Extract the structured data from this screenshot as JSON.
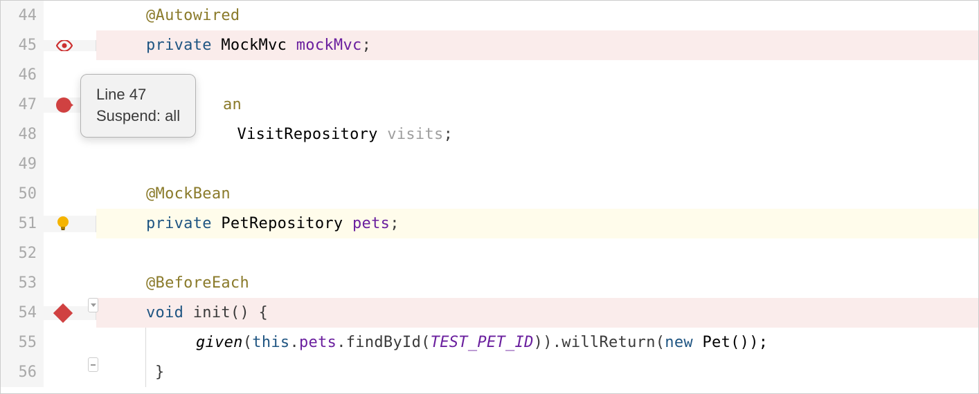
{
  "lines": [
    {
      "num": 44,
      "content_parts": [
        {
          "cls": "c-annotation",
          "text": "@Autowired"
        }
      ],
      "indent": 1
    },
    {
      "num": 45,
      "content_parts": [
        {
          "cls": "c-keyword",
          "text": "private"
        },
        {
          "cls": "",
          "text": " MockMvc "
        },
        {
          "cls": "c-field",
          "text": "mockMvc"
        },
        {
          "cls": "c-punc",
          "text": ";"
        }
      ],
      "indent": 1,
      "bg": "bg-pink",
      "icon": "eye"
    },
    {
      "num": 46,
      "content_parts": [],
      "indent": 0
    },
    {
      "num": 47,
      "content_parts": [
        {
          "cls": "c-annotation",
          "text": "an"
        }
      ],
      "indent": 1,
      "icon": "breakpoint",
      "obscured": true
    },
    {
      "num": 48,
      "content_parts": [
        {
          "cls": "",
          "text": " VisitRepository "
        },
        {
          "cls": "c-visitsfield",
          "text": "visits"
        },
        {
          "cls": "c-punc",
          "text": ";"
        }
      ],
      "indent": 1,
      "obscured_prefix": true
    },
    {
      "num": 49,
      "content_parts": [],
      "indent": 0
    },
    {
      "num": 50,
      "content_parts": [
        {
          "cls": "c-annotation",
          "text": "@MockBean"
        }
      ],
      "indent": 1
    },
    {
      "num": 51,
      "content_parts": [
        {
          "cls": "c-keyword",
          "text": "private"
        },
        {
          "cls": "",
          "text": " PetRepository "
        },
        {
          "cls": "c-field",
          "text": "pets"
        },
        {
          "cls": "c-punc",
          "text": ";"
        }
      ],
      "indent": 1,
      "bg": "bg-yellow",
      "icon": "bulb"
    },
    {
      "num": 52,
      "content_parts": [],
      "indent": 0
    },
    {
      "num": 53,
      "content_parts": [
        {
          "cls": "c-annotation",
          "text": "@BeforeEach"
        }
      ],
      "indent": 1
    },
    {
      "num": 54,
      "content_parts": [
        {
          "cls": "c-keyword",
          "text": "void"
        },
        {
          "cls": "",
          "text": " "
        },
        {
          "cls": "c-method",
          "text": "init"
        },
        {
          "cls": "c-punc",
          "text": "() {"
        }
      ],
      "indent": 1,
      "bg": "bg-pink",
      "icon": "diamond",
      "fold": "down"
    },
    {
      "num": 55,
      "content_parts": [
        {
          "cls": "c-italic",
          "text": "given"
        },
        {
          "cls": "c-punc",
          "text": "("
        },
        {
          "cls": "c-keyword",
          "text": "this"
        },
        {
          "cls": "c-punc",
          "text": "."
        },
        {
          "cls": "c-field",
          "text": "pets"
        },
        {
          "cls": "c-punc",
          "text": ".findById("
        },
        {
          "cls": "c-const",
          "text": "TEST_PET_ID"
        },
        {
          "cls": "c-punc",
          "text": ")).willReturn("
        },
        {
          "cls": "c-keyword",
          "text": "new"
        },
        {
          "cls": "",
          "text": " Pet());"
        }
      ],
      "indent": 3,
      "vbar": true
    },
    {
      "num": 56,
      "content_parts": [
        {
          "cls": "c-punc",
          "text": "}"
        }
      ],
      "indent": 2,
      "fold": "line",
      "vbar": true
    }
  ],
  "tooltip": {
    "line1": "Line 47",
    "line2": "Suspend: all"
  }
}
